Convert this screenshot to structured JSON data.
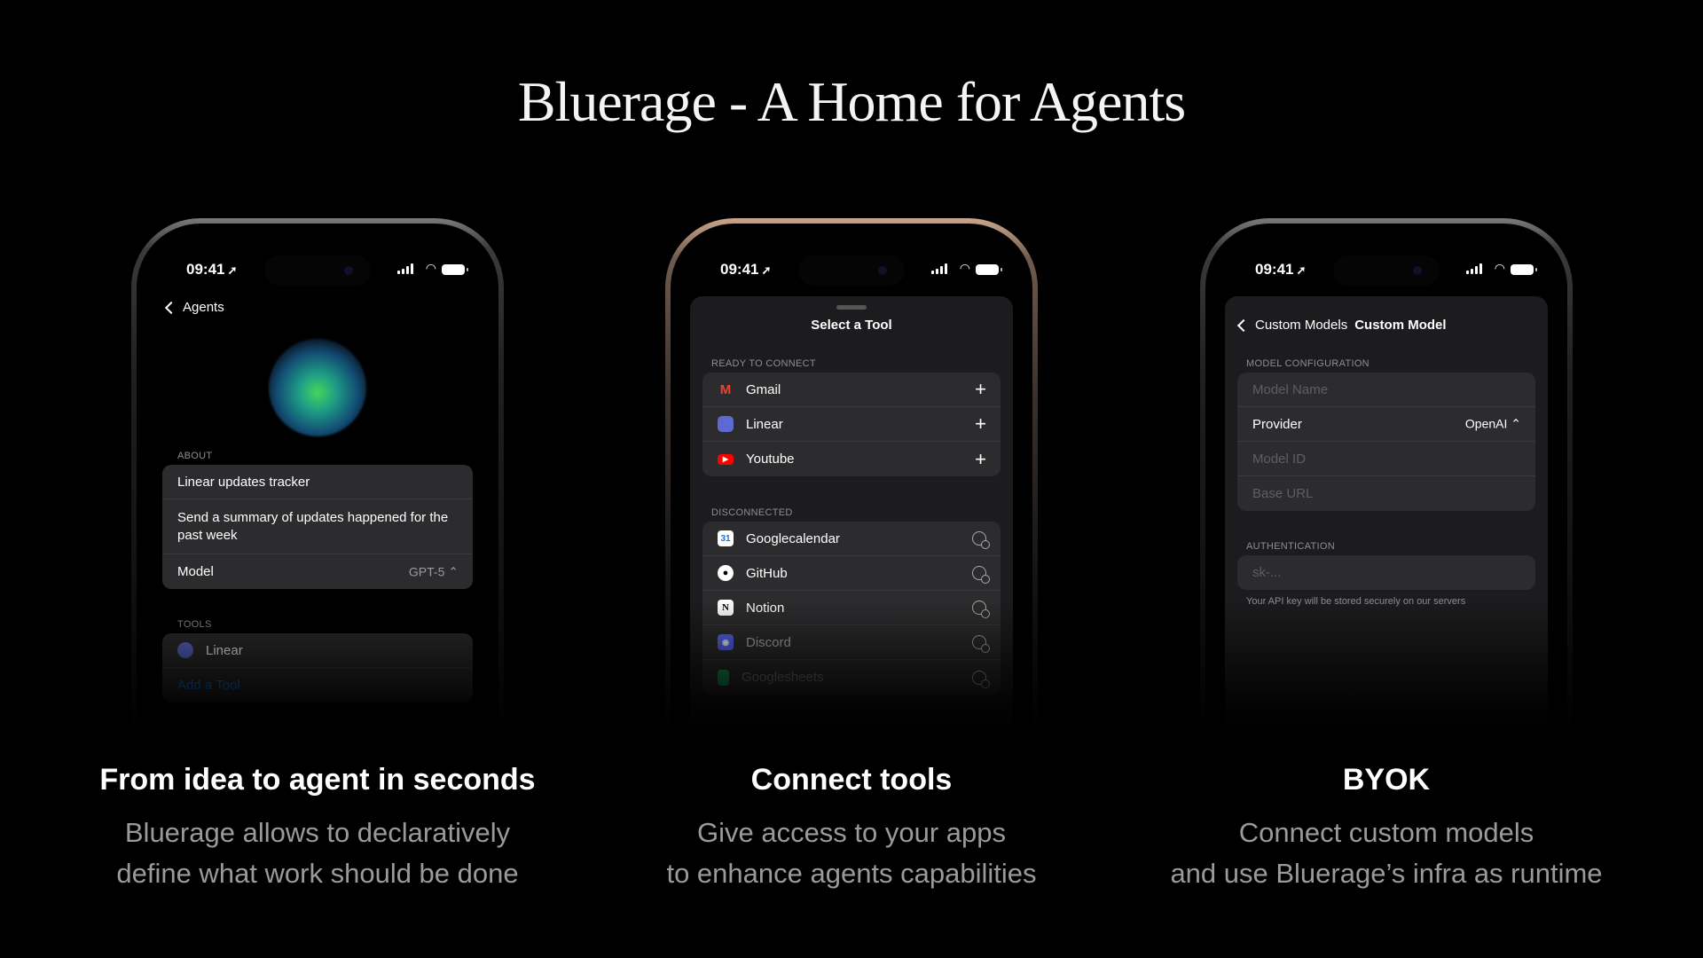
{
  "headline": "Bluerage  - A Home for Agents",
  "status": {
    "time": "09:41"
  },
  "phone1": {
    "back_label": "Agents",
    "about_label": "ABOUT",
    "about_rows": [
      "Linear updates tracker",
      "Send a summary of updates happened for the past week"
    ],
    "model_label": "Model",
    "model_value": "GPT-5 ⌃",
    "tools_label": "TOOLS",
    "tool_linear": "Linear",
    "add_tool": "Add a Tool"
  },
  "phone2": {
    "title": "Select a Tool",
    "ready_label": "READY TO CONNECT",
    "ready": [
      "Gmail",
      "Linear",
      "Youtube"
    ],
    "disconnected_label": "DISCONNECTED",
    "disconnected": [
      "Googlecalendar",
      "GitHub",
      "Notion",
      "Discord",
      "Googlesheets"
    ]
  },
  "phone3": {
    "back_label": "Custom Models",
    "title": "Custom Model",
    "config_label": "MODEL CONFIGURATION",
    "model_name_placeholder": "Model Name",
    "provider_label": "Provider",
    "provider_value": "OpenAI ⌃",
    "model_id_placeholder": "Model ID",
    "base_url_placeholder": "Base URL",
    "auth_label": "AUTHENTICATION",
    "key_placeholder": "sk-...",
    "key_note": "Your API key will be stored securely on our servers"
  },
  "captions": [
    {
      "title": "From idea to agent in seconds",
      "line1": "Bluerage allows to declaratively",
      "line2": "define what work should be done"
    },
    {
      "title": "Connect tools",
      "line1": "Give access to your apps",
      "line2": "to enhance agents capabilities"
    },
    {
      "title": "BYOK",
      "line1": "Connect custom models",
      "line2": "and use Bluerage’s infra as runtime"
    }
  ],
  "colors": {
    "background": "#000000",
    "sheet": "#1c1c1e",
    "row": "#2c2c2e",
    "link": "#0a84ff"
  }
}
